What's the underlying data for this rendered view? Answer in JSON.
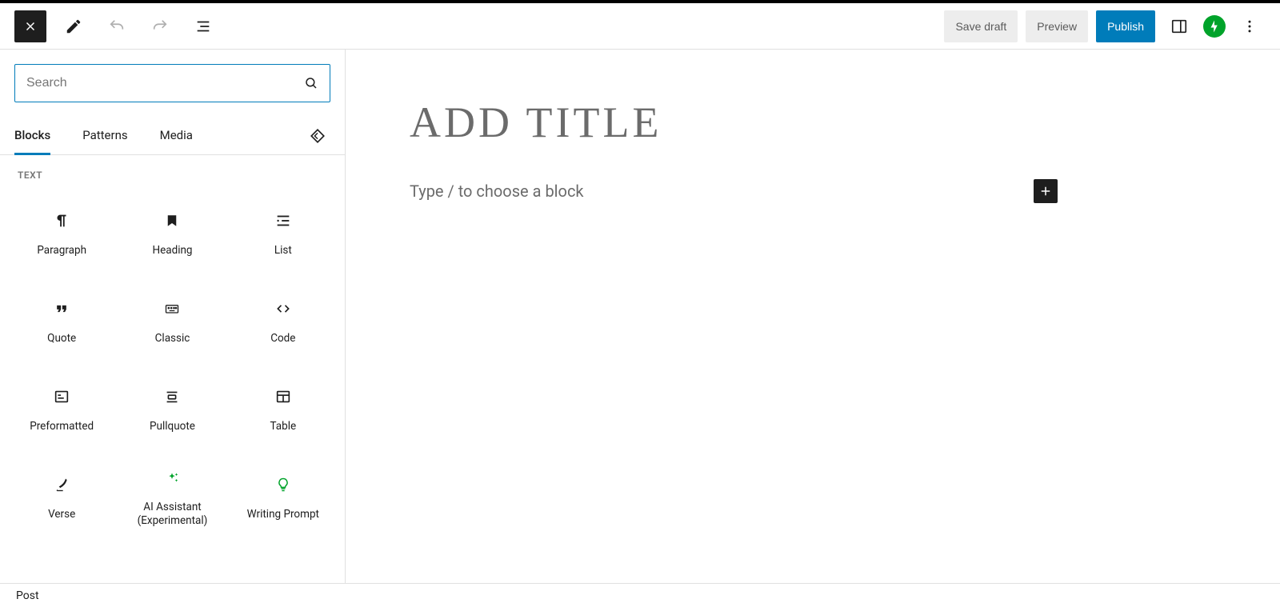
{
  "topbar": {
    "save_draft": "Save draft",
    "preview": "Preview",
    "publish": "Publish"
  },
  "inserter": {
    "search_placeholder": "Search",
    "tabs": {
      "blocks": "Blocks",
      "patterns": "Patterns",
      "media": "Media"
    },
    "section_text": "TEXT",
    "blocks": {
      "paragraph": "Paragraph",
      "heading": "Heading",
      "list": "List",
      "quote": "Quote",
      "classic": "Classic",
      "code": "Code",
      "preformatted": "Preformatted",
      "pullquote": "Pullquote",
      "table": "Table",
      "verse": "Verse",
      "ai_assistant": "AI Assistant (Experimental)",
      "writing_prompt": "Writing Prompt"
    }
  },
  "canvas": {
    "title_placeholder": "ADD TITLE",
    "paragraph_placeholder": "Type / to choose a block"
  },
  "footer": {
    "breadcrumb": "Post"
  }
}
